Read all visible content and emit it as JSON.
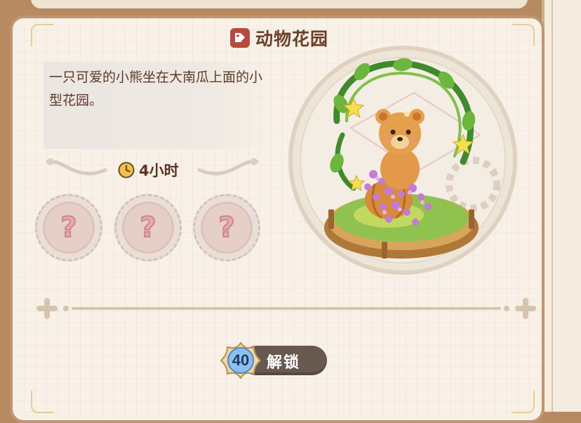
{
  "item": {
    "title": "动物花园",
    "description": "一只可爱的小熊坐在大南瓜上面的小型花园。",
    "duration": "4小时",
    "reward_slots": [
      {
        "label": "?"
      },
      {
        "label": "?"
      },
      {
        "label": "?"
      }
    ]
  },
  "unlock": {
    "level": "40",
    "label": "解锁"
  },
  "icons": {
    "title": "tag-icon",
    "duration": "clock-icon",
    "slot": "question-mark-icon",
    "level": "star-badge-icon",
    "preview": "bear-garden-illustration"
  },
  "colors": {
    "frame": "#c09672",
    "card_bg": "#f7f1e7",
    "title_text": "#6b3f2a",
    "tag": "#b54a3f",
    "button": "#67594e",
    "badge": "#7fb4e6"
  }
}
